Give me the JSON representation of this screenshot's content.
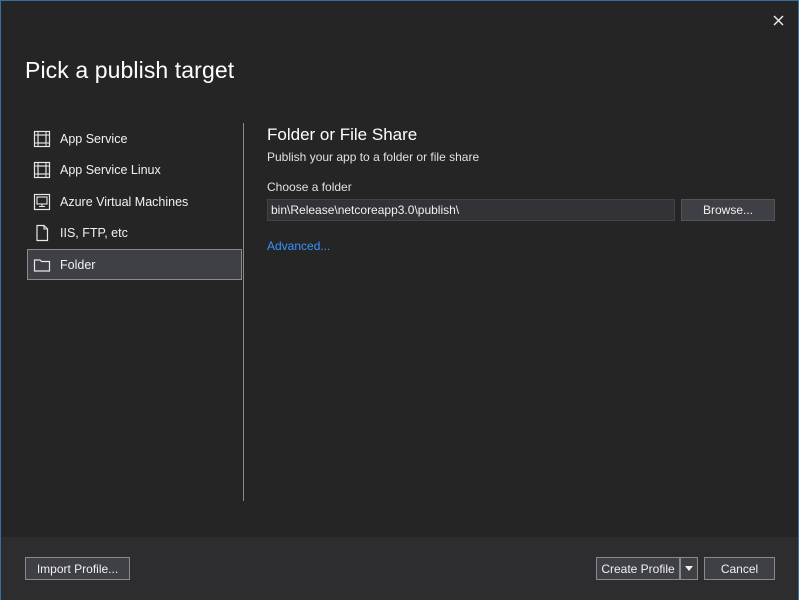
{
  "dialog": {
    "title": "Pick a publish target"
  },
  "targets": [
    {
      "label": "App Service",
      "icon": "app-service-icon",
      "selected": false
    },
    {
      "label": "App Service Linux",
      "icon": "app-service-linux-icon",
      "selected": false
    },
    {
      "label": "Azure Virtual Machines",
      "icon": "virtual-machine-icon",
      "selected": false
    },
    {
      "label": "IIS, FTP, etc",
      "icon": "document-icon",
      "selected": false
    },
    {
      "label": "Folder",
      "icon": "folder-icon",
      "selected": true
    }
  ],
  "detail": {
    "title": "Folder or File Share",
    "subtitle": "Publish your app to a folder or file share",
    "folder_label": "Choose a folder",
    "folder_value": "bin\\Release\\netcoreapp3.0\\publish\\",
    "browse_label": "Browse...",
    "advanced_label": "Advanced..."
  },
  "footer": {
    "import_label": "Import Profile...",
    "create_label": "Create Profile",
    "cancel_label": "Cancel"
  },
  "colors": {
    "background": "#252526",
    "footer": "#2d2d30",
    "link": "#3794ff",
    "border_accent": "#3a6da3"
  }
}
